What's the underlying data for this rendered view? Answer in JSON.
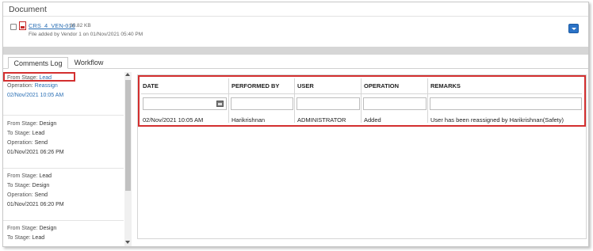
{
  "document": {
    "section_title": "Document",
    "file_name": "CRS_4_VEN-016",
    "file_size": "- 30.82 KB",
    "file_meta": "File added by Vendor 1 on 01/Nov/2021 05:40 PM"
  },
  "tabs": [
    {
      "label": "Comments Log",
      "active": true
    },
    {
      "label": "Workflow",
      "active": false
    }
  ],
  "log_entries": [
    {
      "from_stage_label": "From Stage:",
      "from_stage": "Lead",
      "operation_label": "Operation:",
      "operation": "Reassign",
      "date": "02/Nov/2021 10:05 AM",
      "active": true
    },
    {
      "from_stage_label": "From Stage:",
      "from_stage": "Design",
      "to_stage_label": "To Stage:",
      "to_stage": "Lead",
      "operation_label": "Operation:",
      "operation": "Send",
      "date": "01/Nov/2021 06:26 PM"
    },
    {
      "from_stage_label": "From Stage:",
      "from_stage": "Lead",
      "to_stage_label": "To Stage:",
      "to_stage": "Design",
      "operation_label": "Operation:",
      "operation": "Send",
      "date": "01/Nov/2021 06:20 PM"
    },
    {
      "from_stage_label": "From Stage:",
      "from_stage": "Design",
      "to_stage_label": "To Stage:",
      "to_stage": "Lead"
    }
  ],
  "table": {
    "columns": [
      "DATE",
      "PERFORMED BY",
      "USER",
      "OPERATION",
      "REMARKS"
    ],
    "rows": [
      [
        "02/Nov/2021 10:05 AM",
        "Harikrishnan",
        "ADMINISTRATOR",
        "Added",
        "User has been reassigned by Harikrishnan(Safety)"
      ]
    ]
  },
  "colors": {
    "link": "#2a6fb5",
    "highlight": "#d32f2f",
    "primary_button": "#2b73c7"
  }
}
